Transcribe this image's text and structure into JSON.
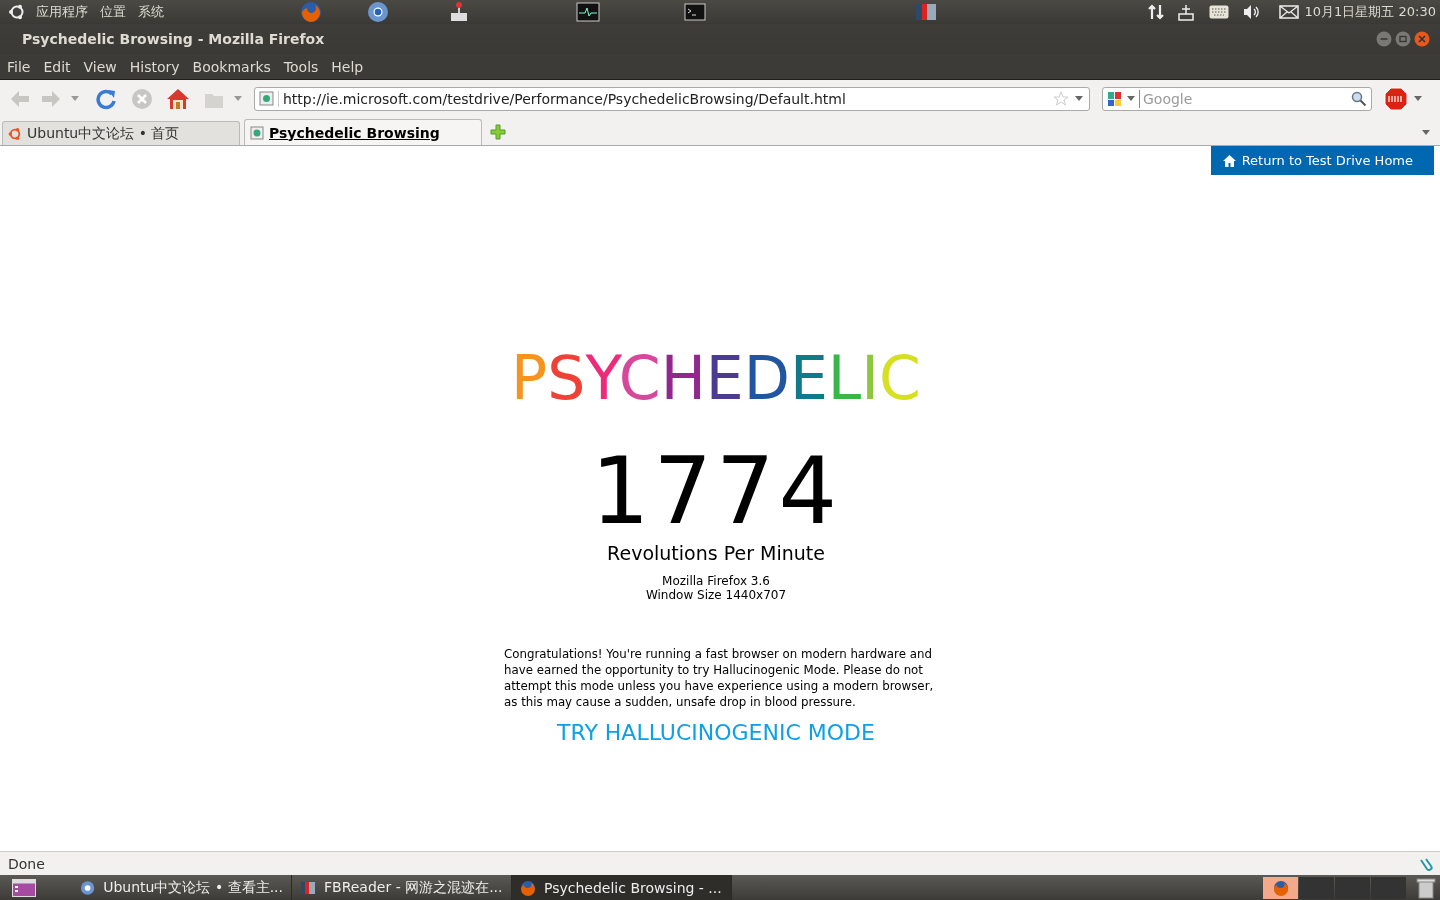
{
  "top_panel": {
    "menus": [
      "应用程序",
      "位置",
      "系统"
    ],
    "clock": "10月1日星期五 20:30"
  },
  "window": {
    "title": "Psychedelic Browsing - Mozilla Firefox"
  },
  "menu_bar": [
    "File",
    "Edit",
    "View",
    "History",
    "Bookmarks",
    "Tools",
    "Help"
  ],
  "address_bar": {
    "value": "http://ie.microsoft.com/testdrive/Performance/PsychedelicBrowsing/Default.html"
  },
  "search": {
    "placeholder": "Google"
  },
  "tabs": [
    {
      "label": "Ubuntu中文论坛 • 首页",
      "selected": false
    },
    {
      "label": "Psychedelic Browsing",
      "selected": true
    }
  ],
  "page": {
    "return_link": "Return to Test Drive Home",
    "title_letters": [
      {
        "char": "P",
        "color": "#f7941d"
      },
      {
        "char": "S",
        "color": "#ef4136"
      },
      {
        "char": "Y",
        "color": "#ee2a7b"
      },
      {
        "char": "C",
        "color": "#d6489c"
      },
      {
        "char": "H",
        "color": "#92278f"
      },
      {
        "char": "E",
        "color": "#4b3b93"
      },
      {
        "char": "D",
        "color": "#21559f"
      },
      {
        "char": "E",
        "color": "#0f7a8a"
      },
      {
        "char": "L",
        "color": "#39b54a"
      },
      {
        "char": "I",
        "color": "#8dc63f"
      },
      {
        "char": "C",
        "color": "#d7df23"
      }
    ],
    "count": "1774",
    "count_label": "Revolutions Per Minute",
    "browser": "Mozilla Firefox 3.6",
    "window_size": "Window Size 1440x707",
    "message": "Congratulations! You're running a fast browser on modern hardware and have earned the opportunity to try Hallucinogenic Mode. Please do not attempt this mode unless you have experience using a modern browser, as this may cause a sudden, unsafe drop in blood pressure.",
    "cta": "TRY HALLUCINOGENIC MODE"
  },
  "status_bar": {
    "text": "Done"
  },
  "taskbar": {
    "items": [
      {
        "label": "Ubuntu中文论坛 • 查看主...",
        "selected": false
      },
      {
        "label": "FBReader - 网游之混迹在...",
        "selected": false
      },
      {
        "label": "Psychedelic Browsing - ...",
        "selected": true
      }
    ]
  }
}
